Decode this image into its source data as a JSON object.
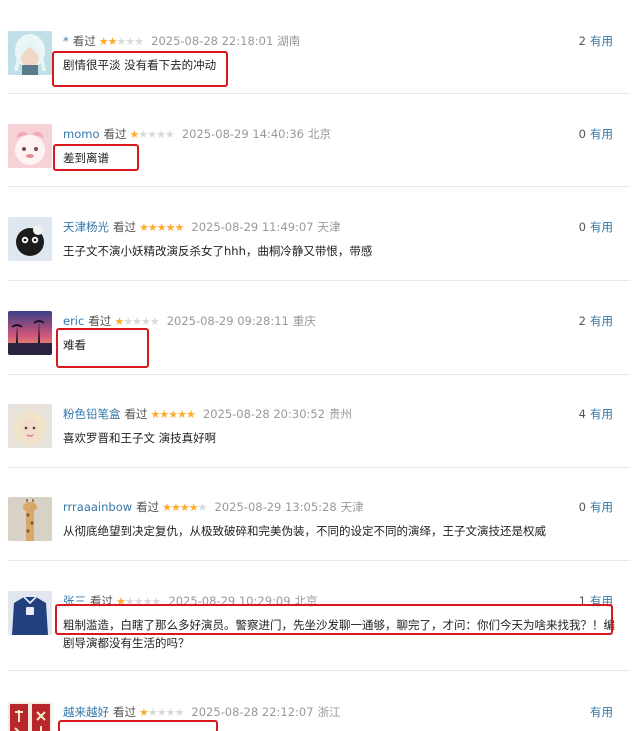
{
  "ui": {
    "watched_label": "看过",
    "useful_label": "有用"
  },
  "comments": [
    {
      "user": "* ",
      "stars": 2,
      "time": "2025-08-28 22:18:01",
      "location": "湖南",
      "votes": "2",
      "text": "剧情很平淡 没有看下去的冲动",
      "avatar_icon": "white-hair-girl-avatar"
    },
    {
      "user": "momo",
      "stars": 1,
      "time": "2025-08-29 14:40:36",
      "location": "北京",
      "votes": "0",
      "text": "差到离谱",
      "avatar_icon": "pink-cartoon-avatar"
    },
    {
      "user": "天津杨光",
      "stars": 5,
      "time": "2025-08-29 11:49:07",
      "location": "天津",
      "votes": "0",
      "text": "王子文不演小妖精改演反杀女了hhh，曲桐冷静又带恨，带感",
      "avatar_icon": "black-cat-avatar"
    },
    {
      "user": "eric",
      "stars": 1,
      "time": "2025-08-29 09:28:11",
      "location": "重庆",
      "votes": "2",
      "text": "难看",
      "avatar_icon": "sunset-avatar"
    },
    {
      "user": "粉色铅笔盒",
      "stars": 5,
      "time": "2025-08-28 20:30:52",
      "location": "贵州",
      "votes": "4",
      "text": "喜欢罗晋和王子文 演技真好啊",
      "avatar_icon": "blonde-girl-avatar"
    },
    {
      "user": "rrraaainbow",
      "stars": 4,
      "time": "2025-08-29 13:05:28",
      "location": "天津",
      "votes": "0",
      "text": "从彻底绝望到决定复仇，从极致破碎和完美伪装，不同的设定不同的演绎，王子文演技还是权威",
      "avatar_icon": "giraffe-avatar"
    },
    {
      "user": "张三",
      "stars": 1,
      "time": "2025-08-29 10:29:09",
      "location": "北京",
      "votes": "1",
      "text": "粗制滥造，白瞎了那么多好演员。警察进门，先坐沙发聊一通够，聊完了，才问：你们今天为啥来找我？！编剧导演都没有生活的吗？",
      "avatar_icon": "blue-shirt-avatar"
    },
    {
      "user": "越来越好",
      "stars": 1,
      "time": "2025-08-28 22:12:07",
      "location": "浙江",
      "votes": "",
      "text": "",
      "avatar_icon": "red-calligraphy-avatar"
    }
  ]
}
